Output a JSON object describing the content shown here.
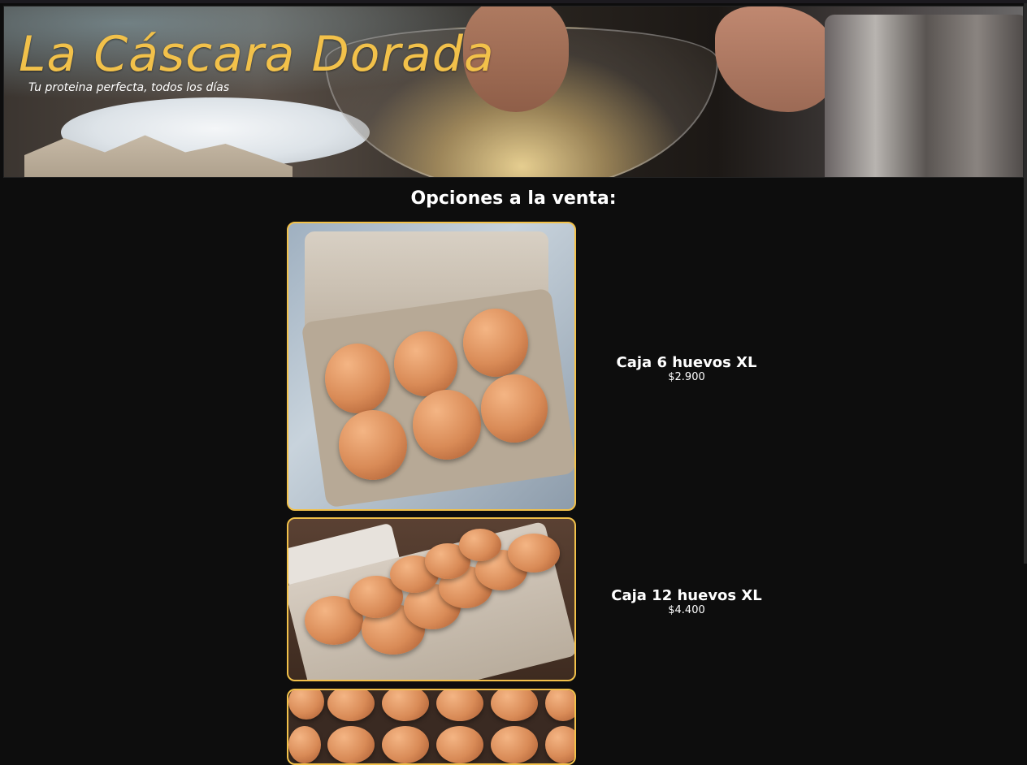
{
  "header": {
    "title": "La Cáscara Dorada",
    "tagline": "Tu proteina perfecta, todos los días",
    "banner_image": "banner-photo-whisking-eggs"
  },
  "main": {
    "section_title": "Opciones a la venta:",
    "products": [
      {
        "name": "Caja 6 huevos XL",
        "price": "$2.900",
        "image": "carton-6-eggs-photo"
      },
      {
        "name": "Caja 12 huevos XL",
        "price": "$4.400",
        "image": "carton-12-eggs-photo"
      },
      {
        "image": "tray-eggs-photo"
      }
    ]
  },
  "colors": {
    "background": "#0d0d0d",
    "accent": "#f2c14a",
    "text": "#ffffff"
  }
}
